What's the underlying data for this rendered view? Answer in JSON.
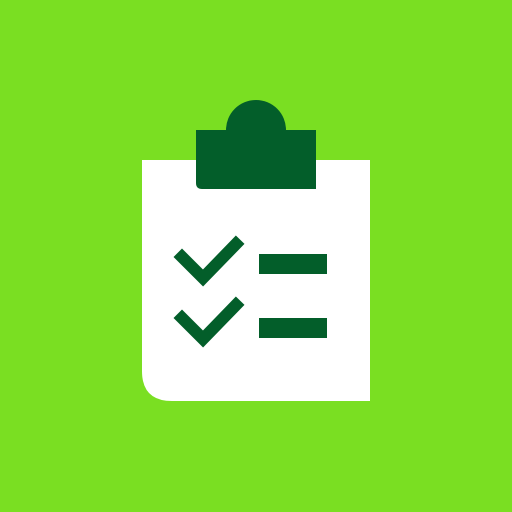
{
  "icon": {
    "name": "clipboard-checklist-icon",
    "checklist_items": 2,
    "checked_items": 2
  },
  "colors": {
    "background": "#7ADF22",
    "paper": "#FFFFFF",
    "accent": "#035E2A"
  }
}
